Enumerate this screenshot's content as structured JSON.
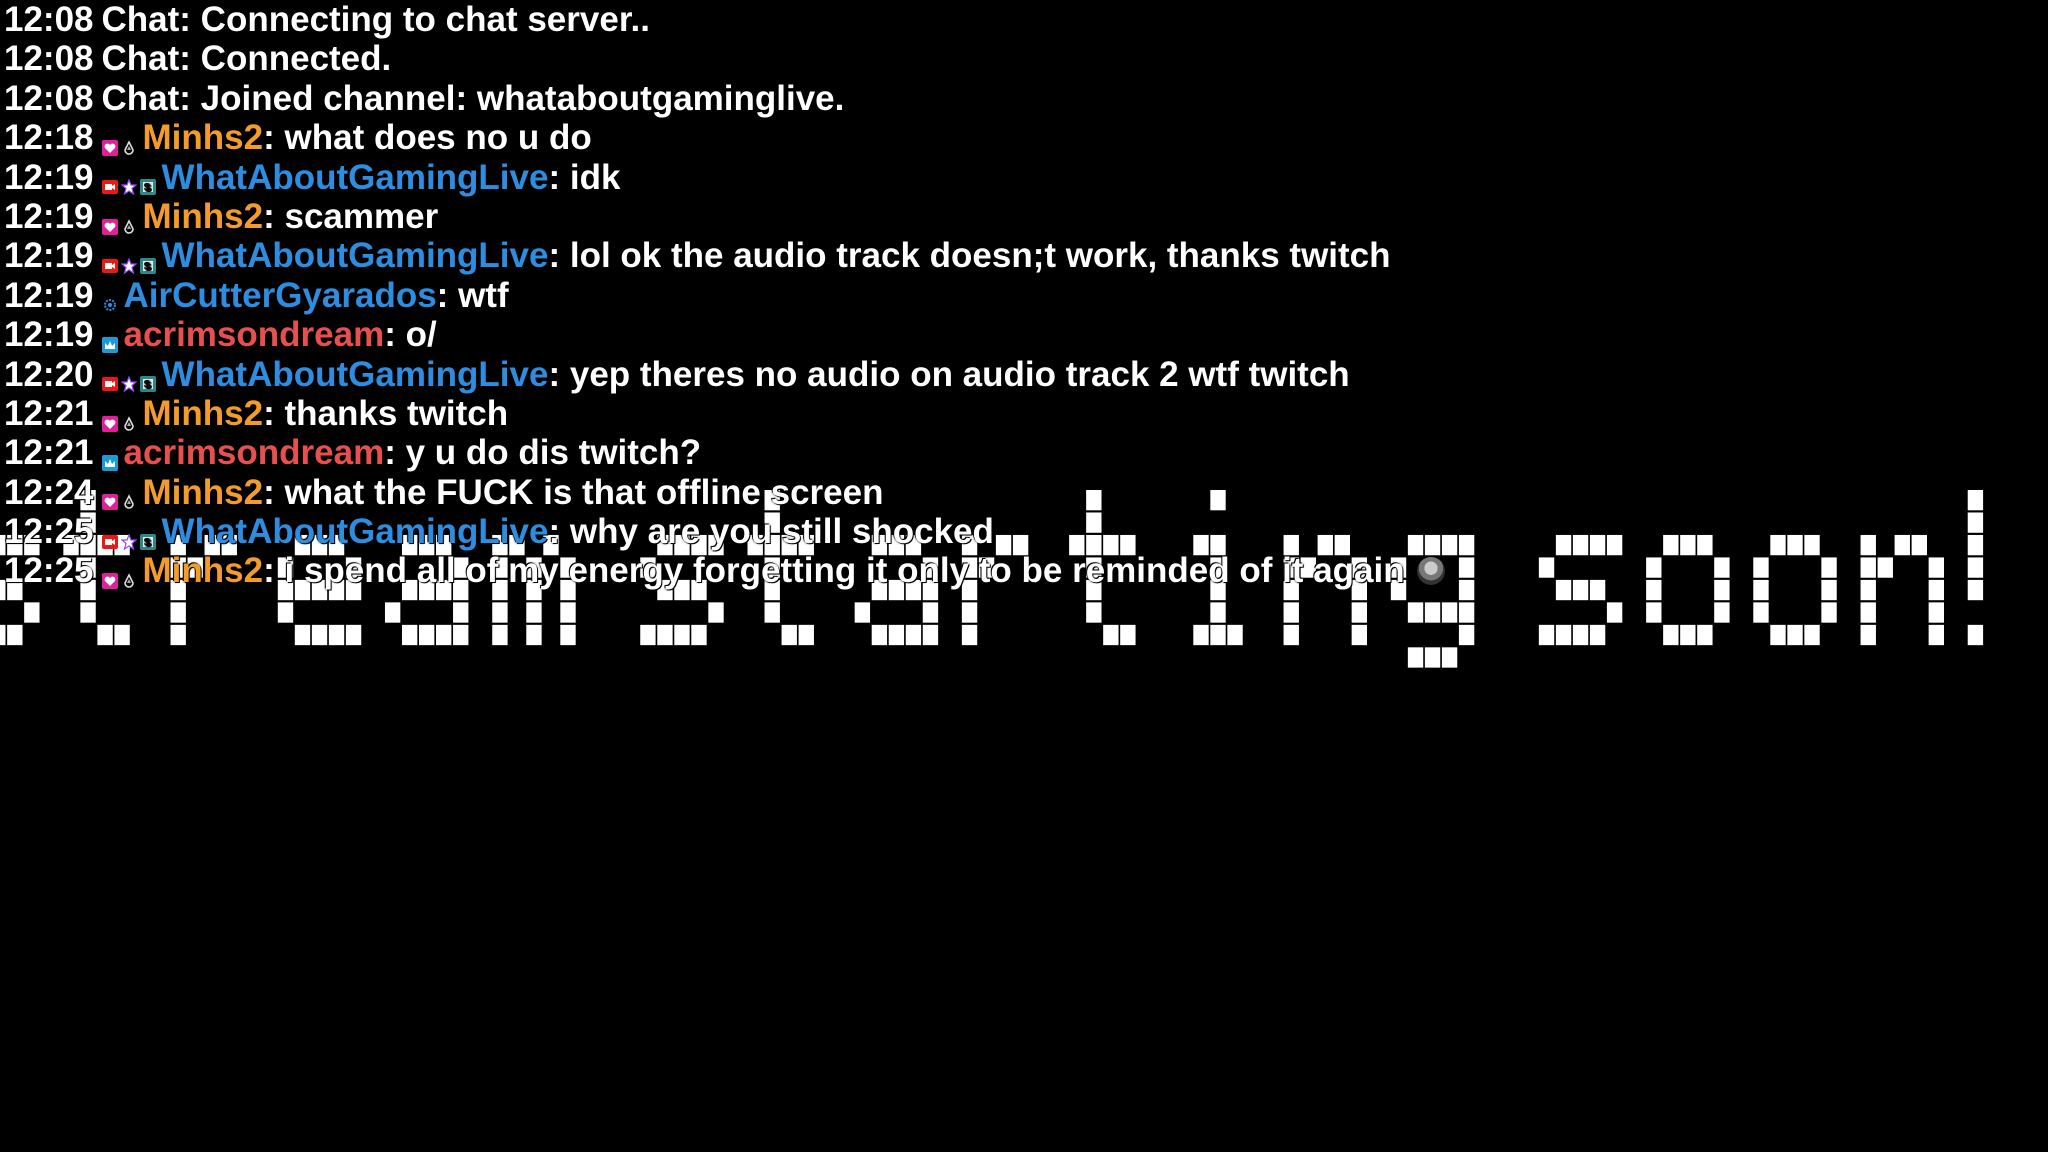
{
  "banner": {
    "text": "stream starting soon!"
  },
  "colors": {
    "background": "#000000",
    "text": "#ffffff",
    "orange_user": "#f39c2b",
    "blue_user": "#2d8de0",
    "red_user": "#e8504f",
    "badge_heart": "#e0209a",
    "badge_broadcaster": "#e91916",
    "badge_vip": "#9146ff",
    "badge_sub": "#2a8a8a",
    "badge_crown": "#1d9bd8"
  },
  "messages": [
    {
      "time": "12:08",
      "system": true,
      "nick": "",
      "sep": "",
      "text": "Chat: Connecting to chat server..",
      "badges": []
    },
    {
      "time": "12:08",
      "system": true,
      "nick": "",
      "sep": "",
      "text": "Chat: Connected.",
      "badges": []
    },
    {
      "time": "12:08",
      "system": true,
      "nick": "",
      "sep": "",
      "text": "Chat: Joined channel: whataboutgaminglive.",
      "badges": []
    },
    {
      "time": "12:18",
      "nick": "Minhs2",
      "color": "orange",
      "sep": ": ",
      "text": "what does no u do",
      "badges": [
        "heart-badge",
        "drop-badge"
      ]
    },
    {
      "time": "12:19",
      "nick": "WhatAboutGamingLive",
      "color": "blue",
      "sep": ": ",
      "text": "idk",
      "badges": [
        "broadcaster-badge",
        "vip-star-badge",
        "sub-badge"
      ]
    },
    {
      "time": "12:19",
      "nick": "Minhs2",
      "color": "orange",
      "sep": ": ",
      "text": "scammer",
      "badges": [
        "heart-badge",
        "drop-badge"
      ]
    },
    {
      "time": "12:19",
      "nick": "WhatAboutGamingLive",
      "color": "blue",
      "sep": ": ",
      "text": "lol ok the audio track doesn;t work, thanks twitch",
      "badges": [
        "broadcaster-badge",
        "vip-star-badge",
        "sub-badge"
      ]
    },
    {
      "time": "12:19",
      "nick": "AirCutterGyarados",
      "color": "blue",
      "sep": ": ",
      "text": "wtf",
      "badges": [
        "gear-badge"
      ]
    },
    {
      "time": "12:19",
      "nick": "acrimsondream",
      "color": "red",
      "sep": ": ",
      "text": "o/",
      "badges": [
        "crown-badge"
      ]
    },
    {
      "time": "12:20",
      "nick": "WhatAboutGamingLive",
      "color": "blue",
      "sep": ": ",
      "text": "yep theres no audio on audio track 2 wtf twitch",
      "badges": [
        "broadcaster-badge",
        "vip-star-badge",
        "sub-badge"
      ]
    },
    {
      "time": "12:21",
      "nick": "Minhs2",
      "color": "orange",
      "sep": ": ",
      "text": "thanks twitch",
      "badges": [
        "heart-badge",
        "drop-badge"
      ]
    },
    {
      "time": "12:21",
      "nick": "acrimsondream",
      "color": "red",
      "sep": ": ",
      "text": "y u do dis twitch?",
      "badges": [
        "crown-badge"
      ]
    },
    {
      "time": "12:24",
      "nick": "Minhs2",
      "color": "orange",
      "sep": ": ",
      "text": "what the FUCK is that offline screen",
      "badges": [
        "heart-badge",
        "drop-badge"
      ]
    },
    {
      "time": "12:25",
      "nick": "WhatAboutGamingLive",
      "color": "blue",
      "sep": ": ",
      "text": "why are you still shocked",
      "badges": [
        "broadcaster-badge",
        "vip-star-badge",
        "sub-badge"
      ]
    },
    {
      "time": "12:25",
      "nick": "Minhs2",
      "color": "orange",
      "sep": ": ",
      "text": "i spend all of my energy forgetting it only to be reminded of it again",
      "badges": [
        "heart-badge",
        "drop-badge"
      ],
      "emote": "face-emote"
    }
  ]
}
